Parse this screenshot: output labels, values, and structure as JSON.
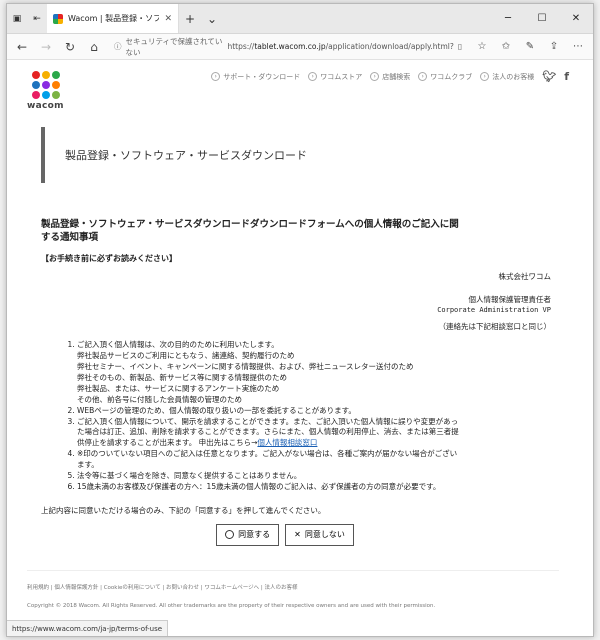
{
  "browser": {
    "tab_title": "Wacom | 製品登録・ソフ",
    "url_warning": "セキュリティで保護されていない",
    "url_scheme": "https://",
    "url_host": "tablet.wacom.co.jp",
    "url_path": "/application/download/apply.html?",
    "status_url": "https://www.wacom.com/ja-jp/terms-of-use"
  },
  "header": {
    "logo_text": "wacom",
    "logo_colors": [
      "#e52323",
      "#f6b000",
      "#2aa84a",
      "#1e73be",
      "#8a2be2",
      "#ff7f00",
      "#e91e63",
      "#00a0e9",
      "#7cb342"
    ],
    "nav": [
      "サポート・ダウンロード",
      "ワコムストア",
      "店舗検索",
      "ワコムクラブ",
      "法人のお客様"
    ],
    "social": [
      "twitter-icon",
      "facebook-icon"
    ]
  },
  "banner": {
    "title": "製品登録・ソフトウェア・サービスダウンロード"
  },
  "form": {
    "title": "製品登録・ソフトウェア・サービスダウンロードダウンロードフォームへの個人情報のご記入に関する通知事項",
    "notice": "【お手続き前に必ずお読みください】",
    "company": "株式会社ワコム",
    "officer": "個人情報保護管理責任者",
    "officer_en": "Corporate Administration VP",
    "contact": "（連絡先は下記相談窓口と同じ）",
    "terms": [
      {
        "text": "ご記入頂く個人情報は、次の目的のために利用いたします。",
        "sub": [
          "弊社製品サービスのご利用にともなう、諸連絡、契約履行のため",
          "弊社セミナー、イベント、キャンペーンに関する情報提供、および、弊社ニュースレター送付のため",
          "弊社そのもの、新製品、新サービス等に関する情報提供のため",
          "弊社製品、または、サービスに関するアンケート実施のため",
          "その他、前各号に付随した会員情報の管理のため"
        ]
      },
      {
        "text": "WEBページの管理のため、個人情報の取り扱いの一部を委託することがあります。",
        "sub": []
      },
      {
        "text": "ご記入頂く個人情報について、開示を請求することができます。また、ご記入頂いた個人情報に誤りや変更があった場合は訂正、追加、削除を請求することができます。さらにまた、個人情報の利用停止、消去、または第三者提供停止を請求することが出来ます。 申出先はこちら→",
        "link": "個人情報相談窓口",
        "sub": []
      },
      {
        "text": "※印のついていない項目へのご記入は任意となります。ご記入がない場合は、各種ご案内が届かない場合がございます。",
        "sub": []
      },
      {
        "text": "法令等に基づく場合を除き、同意なく提供することはありません。",
        "sub": []
      },
      {
        "text": "15歳未満のお客様及び保護者の方へ：15歳未満の個人情報のご記入は、必ず保護者の方の同意が必要です。",
        "sub": []
      }
    ],
    "agree_text": "上記内容に同意いただける場合のみ、下記の「同意する」を押して進んでください。",
    "agree_label": "同意する",
    "disagree_label": "同意しない"
  },
  "footer": {
    "links": "利用規約 | 個人情報保護方針 | Cookieの利用について | お問い合わせ | ワコムホームページへ | 法人のお客様",
    "copyright": "Copyright © 2018 Wacom. All Rights Reserved. All other trademarks are the property of their respective owners and are used with their permission."
  }
}
